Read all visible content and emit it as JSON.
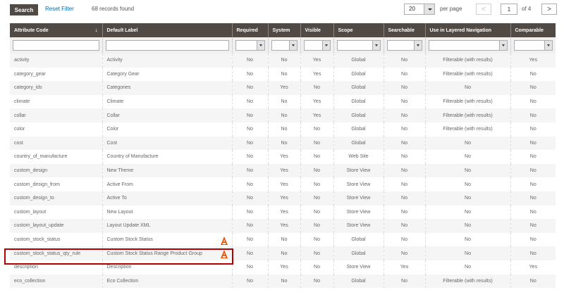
{
  "toolbar": {
    "search_label": "Search",
    "reset_label": "Reset Filter",
    "records_found": "68 records found",
    "per_page_value": "20",
    "per_page_label": "per page",
    "prev_label": "<",
    "current_page": "1",
    "of_pages": "of 4",
    "next_label": ">"
  },
  "columns": [
    "Attribute Code",
    "Default Label",
    "Required",
    "System",
    "Visible",
    "Scope",
    "Searchable",
    "Use in Layered Navigation",
    "Comparable"
  ],
  "sort_indicator": "↓",
  "rows": [
    [
      "activity",
      "Activity",
      "No",
      "No",
      "Yes",
      "Global",
      "No",
      "Filterable (with results)",
      "Yes"
    ],
    [
      "category_gear",
      "Category Gear",
      "No",
      "No",
      "Yes",
      "Global",
      "No",
      "Filterable (with results)",
      "No"
    ],
    [
      "category_ids",
      "Categories",
      "No",
      "Yes",
      "No",
      "Global",
      "No",
      "No",
      "No"
    ],
    [
      "climate",
      "Climate",
      "No",
      "No",
      "Yes",
      "Global",
      "No",
      "Filterable (with results)",
      "No"
    ],
    [
      "collar",
      "Collar",
      "No",
      "No",
      "Yes",
      "Global",
      "No",
      "Filterable (with results)",
      "No"
    ],
    [
      "color",
      "Color",
      "No",
      "No",
      "No",
      "Global",
      "No",
      "Filterable (with results)",
      "No"
    ],
    [
      "cost",
      "Cost",
      "No",
      "No",
      "No",
      "Global",
      "No",
      "No",
      "No"
    ],
    [
      "country_of_manufacture",
      "Country of Manufacture",
      "No",
      "Yes",
      "No",
      "Web Site",
      "No",
      "No",
      "No"
    ],
    [
      "custom_design",
      "New Theme",
      "No",
      "Yes",
      "No",
      "Store View",
      "No",
      "No",
      "No"
    ],
    [
      "custom_design_from",
      "Active From",
      "No",
      "Yes",
      "No",
      "Store View",
      "No",
      "No",
      "No"
    ],
    [
      "custom_design_to",
      "Active To",
      "No",
      "Yes",
      "No",
      "Store View",
      "No",
      "No",
      "No"
    ],
    [
      "custom_layout",
      "New Layout",
      "No",
      "Yes",
      "No",
      "Store View",
      "No",
      "No",
      "No"
    ],
    [
      "custom_layout_update",
      "Layout Update XML",
      "No",
      "Yes",
      "No",
      "Store View",
      "No",
      "No",
      "No"
    ],
    [
      "custom_stock_status",
      "Custom Stock Status",
      "No",
      "No",
      "No",
      "Global",
      "No",
      "No",
      "No"
    ],
    [
      "custom_stock_status_qty_rule",
      "Custom Stock Status Range Product Group",
      "No",
      "No",
      "No",
      "Global",
      "No",
      "No",
      "No"
    ],
    [
      "description",
      "Description",
      "No",
      "Yes",
      "No",
      "Store View",
      "Yes",
      "No",
      "Yes"
    ],
    [
      "eco_collection",
      "Eco Collection",
      "No",
      "No",
      "No",
      "Global",
      "No",
      "Filterable (with results)",
      "No"
    ]
  ],
  "flagged_rows": [
    13,
    14
  ],
  "colors": {
    "header_bg": "#514943",
    "link": "#006bb4",
    "highlight_border": "#b30000",
    "warning_icon": "#eb5202"
  },
  "icons": {
    "sort": "sort-down-arrow-icon",
    "warning": "module-warning-icon"
  }
}
